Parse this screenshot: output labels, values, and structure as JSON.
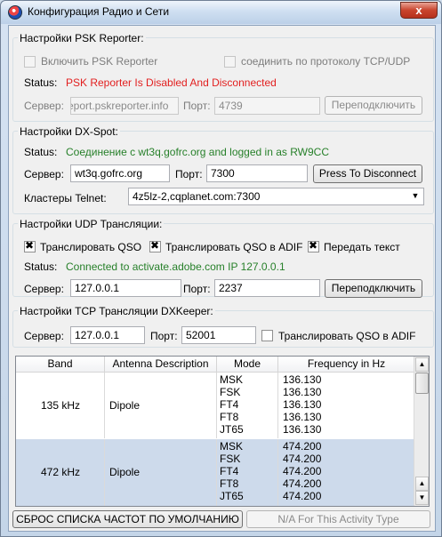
{
  "window": {
    "title": "Конфигурация Радио и Сети",
    "close_glyph": "x"
  },
  "psk": {
    "title": "Настройки PSK Reporter:",
    "enable_label": "Включить PSK Reporter",
    "tcp_label": "соединить по протоколу TCP/UDP",
    "status_label": "Status:",
    "status_text": "PSK Reporter Is Disabled And Disconnected",
    "server_label": "Сервер:",
    "server_value": "report.pskreporter.info",
    "port_label": "Порт:",
    "port_value": "4739",
    "reconnect_label": "Переподключить"
  },
  "dx": {
    "title": "Настройки DX-Spot:",
    "status_label": "Status:",
    "status_text": "Соединение с wt3q.gofrc.org and logged in as RW9CC",
    "server_label": "Сервер:",
    "server_value": "wt3q.gofrc.org",
    "port_label": "Порт:",
    "port_value": "7300",
    "disconnect_label": "Press To Disconnect",
    "clusters_label": "Кластеры Telnet:",
    "clusters_value": "4z5lz-2,cqplanet.com:7300"
  },
  "udp": {
    "title": "Настройки UDP Трансляции:",
    "cb1": "Транслировать QSO",
    "cb2": "Транслировать QSO в ADIF",
    "cb3": "Передать текст",
    "status_label": "Status:",
    "status_text": "Connected to activate.adobe.com IP 127.0.0.1",
    "server_label": "Сервер:",
    "server_value": "127.0.0.1",
    "port_label": "Порт:",
    "port_value": "2237",
    "reconnect_label": "Переподключить"
  },
  "tcp": {
    "title": "Настройки TCP Трансляции DXKeeper:",
    "server_label": "Сервер:",
    "server_value": "127.0.0.1",
    "port_label": "Порт:",
    "port_value": "52001",
    "adif_label": "Транслировать QSO в ADIF"
  },
  "table": {
    "headers": [
      "Band",
      "Antenna Description",
      "Mode",
      "Frequency in Hz"
    ],
    "rows": [
      {
        "band": "135 kHz",
        "antenna": "Dipole",
        "modes": [
          "MSK",
          "FSK",
          "FT4",
          "FT8",
          "JT65"
        ],
        "freqs": [
          "136.130",
          "136.130",
          "136.130",
          "136.130",
          "136.130"
        ]
      },
      {
        "band": "472 kHz",
        "antenna": "Dipole",
        "modes": [
          "MSK",
          "FSK",
          "FT4",
          "FT8",
          "JT65"
        ],
        "freqs": [
          "474.200",
          "474.200",
          "474.200",
          "474.200",
          "474.200"
        ]
      }
    ]
  },
  "footer": {
    "reset_label": "СБРОС СПИСКА ЧАСТОТ ПО УМОЛЧАНИЮ",
    "na_label": "N/A For This Activity Type"
  },
  "colors": {
    "error": "#e21f1f",
    "ok": "#27802a",
    "selected_row": "#cddaeb"
  }
}
